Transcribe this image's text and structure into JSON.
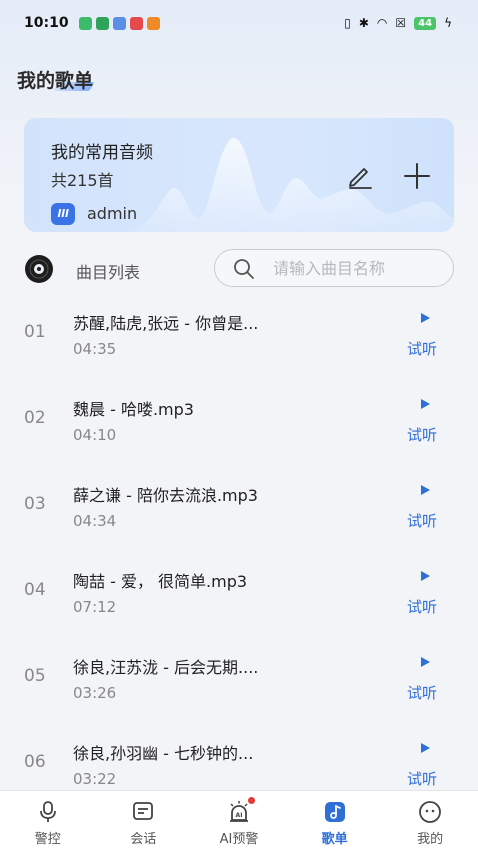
{
  "status_bar": {
    "time": "10:10",
    "battery": "44"
  },
  "page": {
    "title": "我的歌单"
  },
  "playlist_card": {
    "title": "我的常用音频",
    "count": "共215首",
    "avatar_text": "lll",
    "user": "admin"
  },
  "list_header": {
    "label": "曲目列表",
    "search_placeholder": "请输入曲目名称"
  },
  "songs": [
    {
      "index": "01",
      "name": "苏醒,陆虎,张远 - 你曾是...",
      "duration": "04:35",
      "action": "试听"
    },
    {
      "index": "02",
      "name": "魏晨 - 哈喽.mp3",
      "duration": "04:10",
      "action": "试听"
    },
    {
      "index": "03",
      "name": "薛之谦 - 陪你去流浪.mp3",
      "duration": "04:34",
      "action": "试听"
    },
    {
      "index": "04",
      "name": "陶喆 - 爱， 很简单.mp3",
      "duration": "07:12",
      "action": "试听"
    },
    {
      "index": "05",
      "name": "徐良,汪苏泷 - 后会无期....",
      "duration": "03:26",
      "action": "试听"
    },
    {
      "index": "06",
      "name": "徐良,孙羽幽 - 七秒钟的...",
      "duration": "03:22",
      "action": "试听"
    }
  ],
  "bottom_nav": {
    "items": [
      {
        "label": "警控",
        "icon": "microphone-icon"
      },
      {
        "label": "会话",
        "icon": "chat-icon"
      },
      {
        "label": "AI预警",
        "icon": "ai-alarm-icon"
      },
      {
        "label": "歌单",
        "icon": "playlist-icon",
        "active": true
      },
      {
        "label": "我的",
        "icon": "profile-icon"
      }
    ]
  },
  "colors": {
    "accent": "#2f6fd8",
    "card_bg": "#d6e6fc",
    "badge": "#e53935"
  }
}
